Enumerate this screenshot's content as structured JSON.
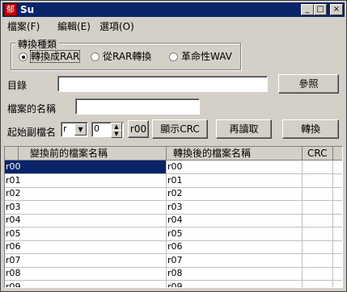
{
  "window": {
    "title": "Su",
    "icon_text": "郁",
    "controls": [
      "_",
      "□",
      "×"
    ]
  },
  "menu": [
    {
      "label": "檔案(F)"
    },
    {
      "label": "編輯(E)"
    },
    {
      "label": "選項(O)"
    }
  ],
  "conversion_group": {
    "title": "轉換種類",
    "options": [
      {
        "label": "轉換成RAR",
        "selected": true
      },
      {
        "label": "從RAR轉換",
        "selected": false
      },
      {
        "label": "革命性WAV",
        "selected": false
      }
    ]
  },
  "directory": {
    "label": "目錄",
    "value": "",
    "browse_label": "參照"
  },
  "filename": {
    "label": "檔案的名稱",
    "value": ""
  },
  "extension": {
    "label": "起始副檔名",
    "prefix_value": "r",
    "start_value": "0",
    "preview_label": "r00",
    "show_crc_label": "顯示CRC",
    "reload_label": "再讀取",
    "convert_label": "轉換"
  },
  "table": {
    "columns": [
      "變換前的檔案名稱",
      "轉換後的檔案名稱",
      "CRC"
    ],
    "rows": [
      {
        "before": "r00",
        "after": "r00",
        "crc": ""
      },
      {
        "before": "r01",
        "after": "r01",
        "crc": ""
      },
      {
        "before": "r02",
        "after": "r02",
        "crc": ""
      },
      {
        "before": "r03",
        "after": "r03",
        "crc": ""
      },
      {
        "before": "r04",
        "after": "r04",
        "crc": ""
      },
      {
        "before": "r05",
        "after": "r05",
        "crc": ""
      },
      {
        "before": "r06",
        "after": "r06",
        "crc": ""
      },
      {
        "before": "r07",
        "after": "r07",
        "crc": ""
      },
      {
        "before": "r08",
        "after": "r08",
        "crc": ""
      },
      {
        "before": "r09",
        "after": "r09",
        "crc": ""
      }
    ]
  }
}
